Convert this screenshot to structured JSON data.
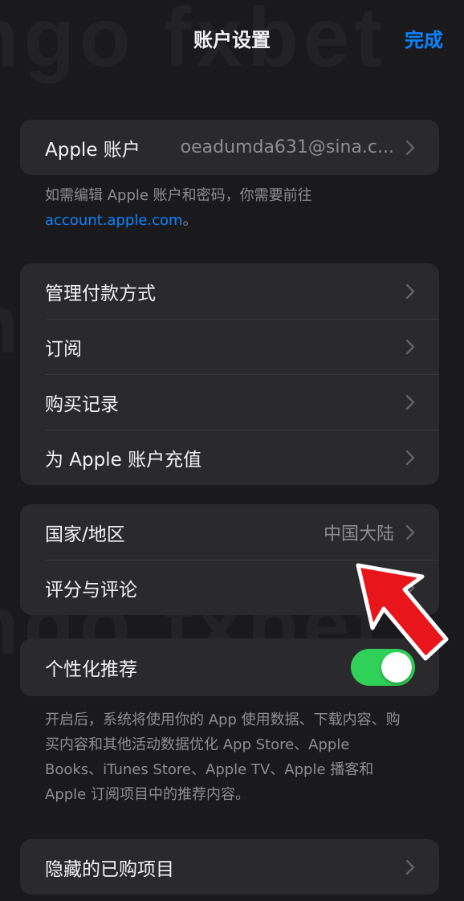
{
  "nav": {
    "title": "账户设置",
    "done_label": "完成"
  },
  "watermark": {
    "text": "ngo  fxbet"
  },
  "account": {
    "label": "Apple 账户",
    "value": "oeadumda631@sina.c...",
    "footer_text": "如需编辑 Apple 账户和密码，你需要前往",
    "footer_link": "account.apple.com",
    "footer_end": "。"
  },
  "payments": {
    "items": [
      {
        "label": "管理付款方式"
      },
      {
        "label": "订阅"
      },
      {
        "label": "购买记录"
      },
      {
        "label": "为 Apple 账户充值"
      }
    ]
  },
  "region": {
    "label": "国家/地区",
    "value": "中国大陆",
    "ratings_label": "评分与评论"
  },
  "personalization": {
    "label": "个性化推荐",
    "toggle_on": true,
    "footer": "开启后，系统将使用你的 App 使用数据、下载内容、购买内容和其他活动数据优化 App Store、Apple Books、iTunes Store、Apple TV、Apple 播客和 Apple 订阅项目中的推荐内容。"
  },
  "hidden": {
    "label": "隐藏的已购项目"
  },
  "colors": {
    "accent": "#0a84ff",
    "toggle_on": "#30d158",
    "arrow": "#e8151b"
  },
  "icons": {
    "chevron": "chevron-right-icon",
    "arrow": "red-pointer-arrow"
  }
}
